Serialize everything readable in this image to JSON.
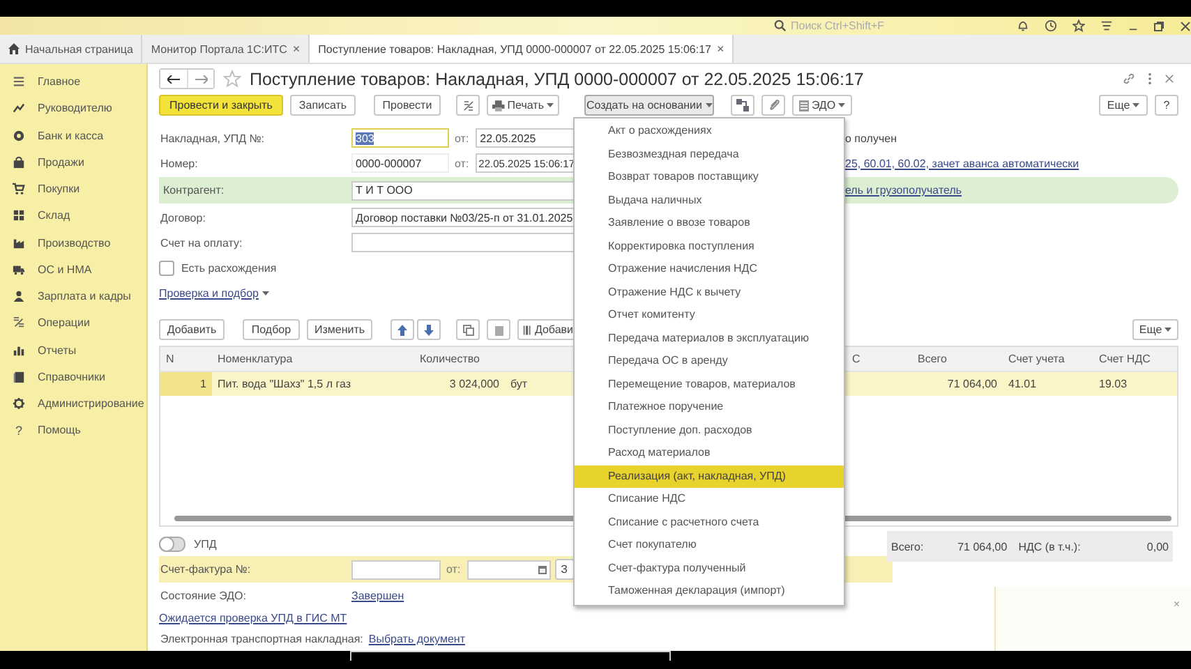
{
  "top_bar": {
    "search": {
      "placeholder": "Поиск Ctrl+Shift+F"
    }
  },
  "tabs": [
    {
      "label": "Начальная страница",
      "selected": false
    },
    {
      "label": "Монитор Портала 1С:ИТС",
      "selected": false,
      "close": "×"
    },
    {
      "label": "Поступление товаров: Накладная, УПД 0000-000007 от 22.05.2025 15:06:17",
      "selected": true,
      "close": "×"
    }
  ],
  "sidebar": {
    "items": [
      {
        "label": "Главное"
      },
      {
        "label": "Руководителю"
      },
      {
        "label": "Банк и касса"
      },
      {
        "label": "Продажи"
      },
      {
        "label": "Покупки"
      },
      {
        "label": "Склад"
      },
      {
        "label": "Производство"
      },
      {
        "label": "ОС и НМА"
      },
      {
        "label": "Зарплата и кадры"
      },
      {
        "label": "Операции"
      },
      {
        "label": "Отчеты"
      },
      {
        "label": "Справочники"
      },
      {
        "label": "Администрирование"
      },
      {
        "label": "Помощь",
        "glyph": "?"
      }
    ]
  },
  "document": {
    "title": "Поступление товаров: Накладная, УПД 0000-000007 от 22.05.2025 15:06:17",
    "toolbar": {
      "post_close": "Провести и закрыть",
      "save": "Записать",
      "post": "Провести",
      "print": "Печать",
      "create_based": "Создать на основании",
      "edo": "ЭДО",
      "more": "Еще",
      "help": "?"
    },
    "fields": {
      "invoice_label": "Накладная, УПД №:",
      "invoice_value": "303",
      "date_label": "от:",
      "invoice_date": "22.05.2025",
      "status_text": "о получен",
      "number_label": "Номер:",
      "number_value": "0000-000007",
      "number_date_label": "от:",
      "number_date": "22.05.2025 15:06:17",
      "accounts_link": "25, 60.01, 60.02, зачет аванса автоматически",
      "counterparty_label": "Контрагент:",
      "counterparty_value": "Т И Т ООО",
      "shipper_link": "ель и грузополучатель",
      "contract_label": "Договор:",
      "contract_value": "Договор поставки №03/25-п от 31.01.2025",
      "payment_label": "Счет на оплату:",
      "discrepancy": {
        "label": "Есть расхождения",
        "checked": false
      },
      "check_link": "Проверка и подбор"
    },
    "table_toolbar": {
      "add": "Добавить",
      "pick": "Подбор",
      "edit": "Изменить",
      "add_cut": "Добави",
      "more": "Еще"
    },
    "table": {
      "columns": [
        "N",
        "Номенклатура",
        "Количество",
        "",
        "С",
        "Всего",
        "Счет учета",
        "Счет НДС"
      ],
      "rows": [
        {
          "cells": [
            "1",
            "Пит. вода \"Шахз\" 1,5 л газ",
            "3 024,000",
            "бут",
            "",
            "71 064,00",
            "41.01",
            "19.03"
          ],
          "selected": true
        }
      ]
    },
    "upd_toggle": {
      "label": "УПД",
      "on": false
    },
    "invoice_row": {
      "label": "Счет-фактура №:",
      "date_label": "от:",
      "button_cut": "З"
    },
    "totals": {
      "total_label": "Всего:",
      "total_value": "71 064,00",
      "vat_label": "НДС (в т.ч.):",
      "vat_value": "0,00"
    },
    "edo_state": {
      "label": "Состояние ЭДО:",
      "value": "Завершен"
    },
    "gis_link": "Ожидается проверка УПД в ГИС МТ",
    "etn": {
      "label": "Электронная транспортная накладная:",
      "value": "Выбрать документ"
    }
  },
  "dropdown": {
    "items": [
      {
        "label": "Акт о расхождениях",
        "selected": false
      },
      {
        "label": "Безвозмездная передача",
        "selected": false
      },
      {
        "label": "Возврат товаров поставщику",
        "selected": false
      },
      {
        "label": "Выдача наличных",
        "selected": false
      },
      {
        "label": "Заявление о ввозе товаров",
        "selected": false
      },
      {
        "label": "Корректировка поступления",
        "selected": false
      },
      {
        "label": "Отражение начисления НДС",
        "selected": false
      },
      {
        "label": "Отражение НДС к вычету",
        "selected": false
      },
      {
        "label": "Отчет комитенту",
        "selected": false
      },
      {
        "label": "Передача материалов в эксплуатацию",
        "selected": false
      },
      {
        "label": "Передача ОС в аренду",
        "selected": false
      },
      {
        "label": "Перемещение товаров, материалов",
        "selected": false
      },
      {
        "label": "Платежное поручение",
        "selected": false
      },
      {
        "label": "Поступление доп. расходов",
        "selected": false
      },
      {
        "label": "Расход материалов",
        "selected": false
      },
      {
        "label": "Реализация (акт, накладная, УПД)",
        "selected": true
      },
      {
        "label": "Списание НДС",
        "selected": false
      },
      {
        "label": "Списание с расчетного счета",
        "selected": false
      },
      {
        "label": "Счет покупателю",
        "selected": false
      },
      {
        "label": "Счет-фактура полученный",
        "selected": false
      },
      {
        "label": "Таможенная декларация (импорт)",
        "selected": false
      }
    ]
  },
  "notification": {
    "close": "×"
  }
}
